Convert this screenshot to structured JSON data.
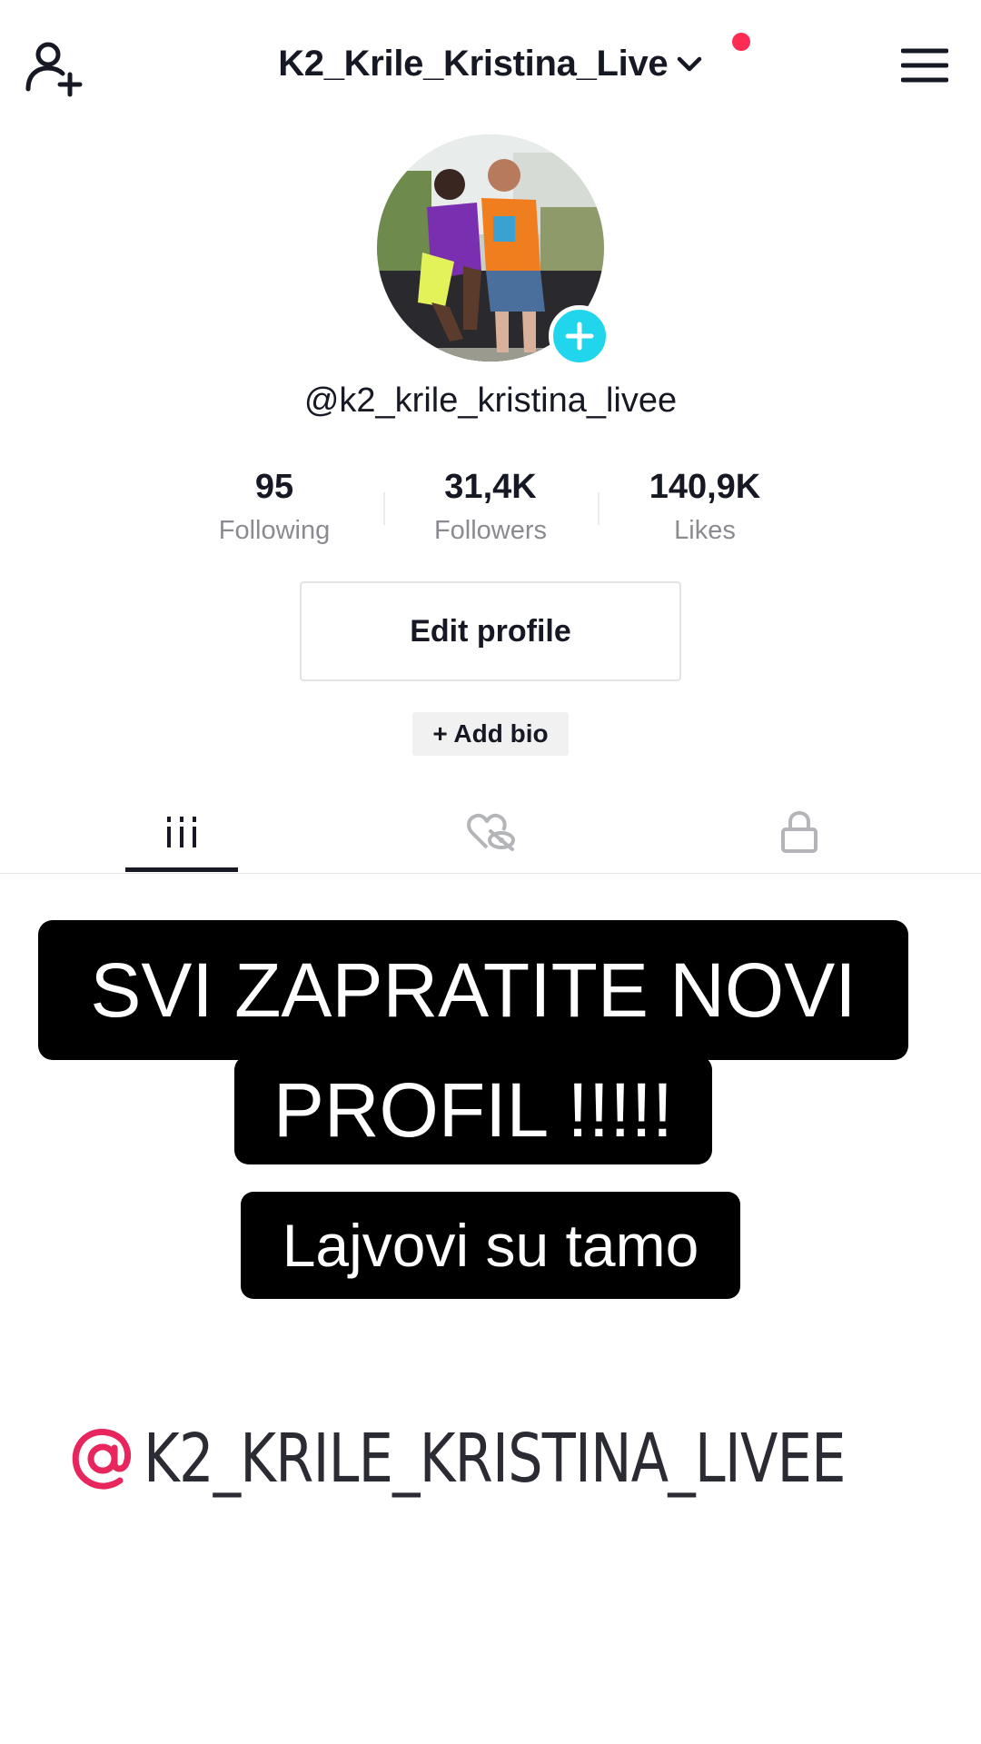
{
  "header": {
    "title": "K2_Krile_Kristina_Live",
    "add_user_icon": "add-user-icon",
    "chevron_icon": "chevron-down-icon",
    "menu_icon": "hamburger-menu-icon",
    "notification_color": "#fe2c55"
  },
  "profile": {
    "handle": "@k2_krile_kristina_livee",
    "avatar_badge_icon": "plus-icon",
    "avatar_badge_color": "#20d5ec"
  },
  "stats": [
    {
      "value": "95",
      "label": "Following"
    },
    {
      "value": "31,4K",
      "label": "Followers"
    },
    {
      "value": "140,9K",
      "label": "Likes"
    }
  ],
  "actions": {
    "edit_profile": "Edit profile",
    "add_bio": "+ Add bio"
  },
  "tabs": [
    {
      "icon": "videos-grid-icon",
      "active": true
    },
    {
      "icon": "liked-hidden-icon",
      "active": false
    },
    {
      "icon": "lock-icon",
      "active": false
    }
  ],
  "overlay": {
    "caption_line1": "SVI ZAPRATITE NOVI",
    "caption_line2": "PROFIL !!!!!",
    "caption_line3": "Lajvovi su tamo",
    "mention": "K2_KRILE_KRISTINA_LIVEE",
    "mention_color": "#e8265e"
  }
}
